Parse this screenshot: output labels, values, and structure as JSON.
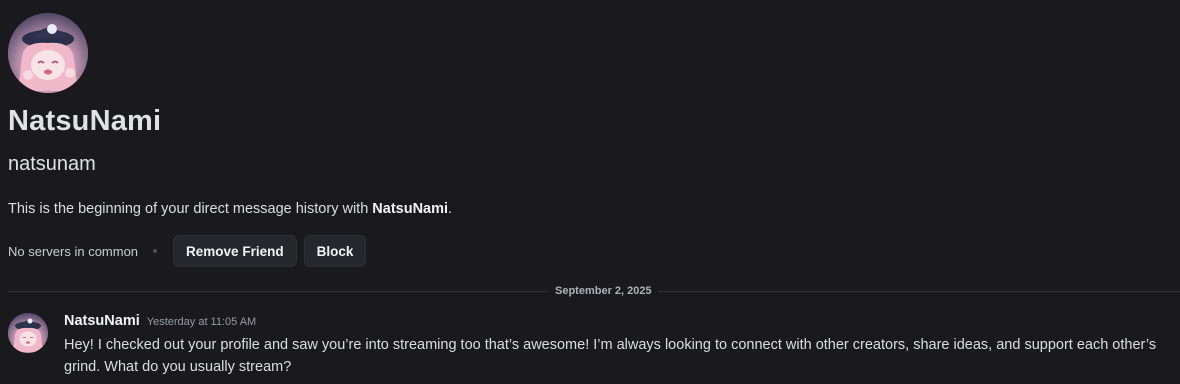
{
  "profile": {
    "display_name": "NatsuNami",
    "username": "natsunam",
    "intro_prefix": "This is the beginning of your direct message history with ",
    "intro_name": "NatsuNami",
    "intro_suffix": "."
  },
  "actions": {
    "mutual_servers": "No servers in common",
    "remove_friend_label": "Remove Friend",
    "block_label": "Block"
  },
  "date_divider": "September 2, 2025",
  "messages": [
    {
      "author": "NatsuNami",
      "timestamp": "Yesterday at 11:05 AM",
      "text": "Hey! I checked out your profile and saw you’re into streaming too that’s awesome! I’m always looking to connect with other creators, share ideas, and support each other’s grind. What do you usually stream?"
    }
  ],
  "colors": {
    "background": "#1a1a1e",
    "button_bg": "#26272d",
    "divider": "#2f3036",
    "text_primary": "#f2f3f5",
    "text_muted": "#949ba4"
  },
  "icons": {
    "avatar": "anime-avatar-image"
  }
}
